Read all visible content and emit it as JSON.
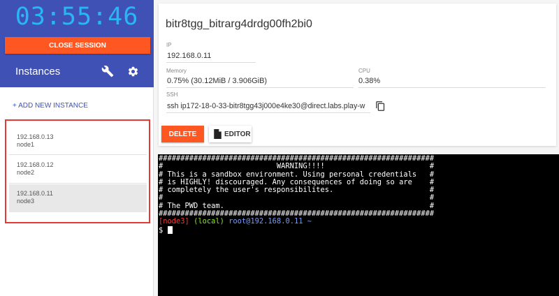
{
  "sidebar": {
    "timer": "03:55:46",
    "close_session_label": "CLOSE SESSION",
    "instances_title": "Instances",
    "add_instance_label": "+ ADD NEW INSTANCE",
    "instances": [
      {
        "ip": "192.168.0.13",
        "name": "node1",
        "selected": false
      },
      {
        "ip": "192.168.0.12",
        "name": "node2",
        "selected": false
      },
      {
        "ip": "192.168.0.11",
        "name": "node3",
        "selected": true
      }
    ]
  },
  "card": {
    "title": "bitr8tgg_bitrarg4drdg00fh2bi0",
    "ip_label": "IP",
    "ip_value": "192.168.0.11",
    "memory_label": "Memory",
    "memory_value": "0.75% (30.12MiB / 3.906GiB)",
    "cpu_label": "CPU",
    "cpu_value": "0.38%",
    "ssh_label": "SSH",
    "ssh_value": "ssh ip172-18-0-33-bitr8tgg43j000e4ke30@direct.labs.play-w",
    "delete_label": "DELETE",
    "editor_label": "EDITOR"
  },
  "terminal": {
    "border_line": "###############################################################",
    "warning_line": "#                          WARNING!!!!                        #",
    "line1": "# This is a sandbox environment. Using personal credentials   #",
    "line2": "# is HIGHLY! discouraged. Any consequences of doing so are    #",
    "line3": "# completely the user's responsibilites.                      #",
    "line_empty": "#                                                             #",
    "line_team": "# The PWD team.                                               #",
    "prompt_node": "[node3]",
    "prompt_local": "(local)",
    "prompt_host": "root@192.168.0.11 ~",
    "prompt_symbol": "$ "
  },
  "colors": {
    "sidebar_header": "#3f51b5",
    "timer": "#29b6f6",
    "accent_button": "#ff5722",
    "selection_border": "#e53935"
  },
  "icons": {
    "wrench": "wrench-icon",
    "gear": "gear-icon",
    "copy": "copy-icon",
    "file": "file-icon"
  }
}
